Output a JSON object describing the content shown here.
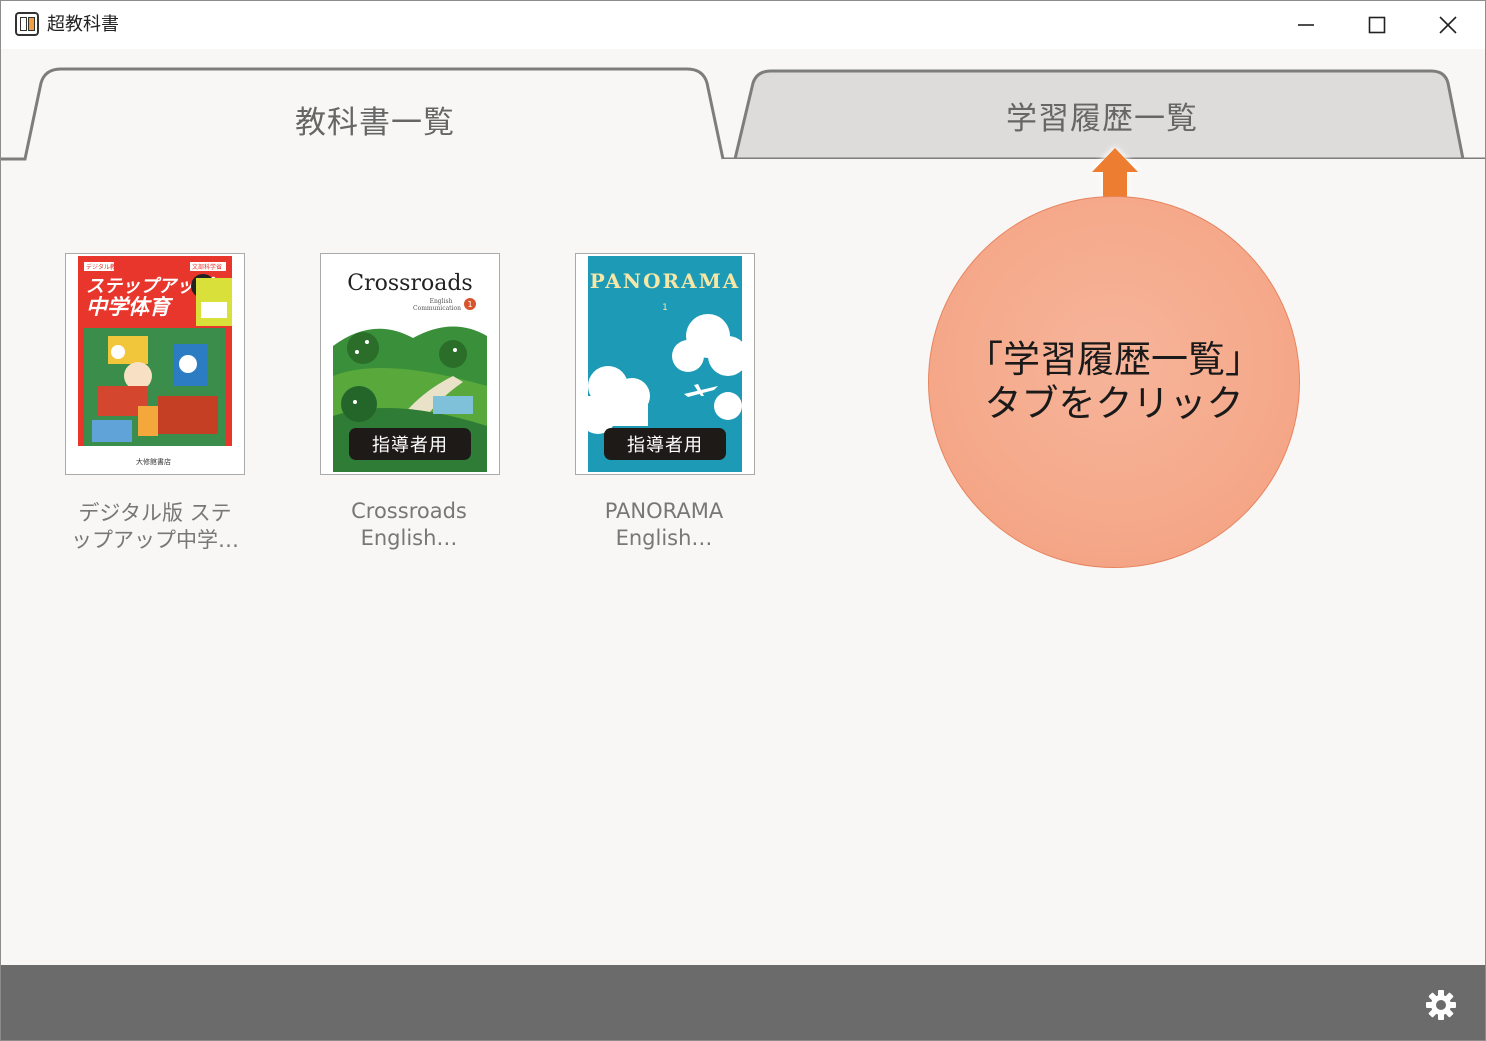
{
  "window": {
    "app_title": "超教科書",
    "minimize_icon": "minimize-icon",
    "maximize_icon": "maximize-icon",
    "close_icon": "close-icon"
  },
  "tabs": [
    {
      "label": "教科書一覧",
      "active": true
    },
    {
      "label": "学習履歴一覧",
      "active": false
    }
  ],
  "books": [
    {
      "caption_line1": "デジタル版 ステ",
      "caption_line2": "ップアップ中学…",
      "cover": {
        "top_left": "デジタル教科書",
        "top_right": "文部科学省",
        "title_line1": "ステップアップ",
        "title_line2": "中学体育",
        "publisher": "大修館書店"
      }
    },
    {
      "caption_line1": "Crossroads",
      "caption_line2": "English…",
      "cover": {
        "title": "Crossroads",
        "subtitle_line1": "English",
        "subtitle_line2": "Communication",
        "volume": "1",
        "badge": "指導者用"
      }
    },
    {
      "caption_line1": "PANORAMA",
      "caption_line2": "English…",
      "cover": {
        "title": "PANORAMA",
        "volume": "1",
        "badge": "指導者用"
      }
    }
  ],
  "callout": {
    "line1": "「学習履歴一覧」",
    "line2": "タブをクリック",
    "color": "#f5a98a",
    "arrow_color": "#ed7d31"
  },
  "bottombar": {
    "settings_icon": "gear-icon",
    "color": "#6b6b6b"
  }
}
